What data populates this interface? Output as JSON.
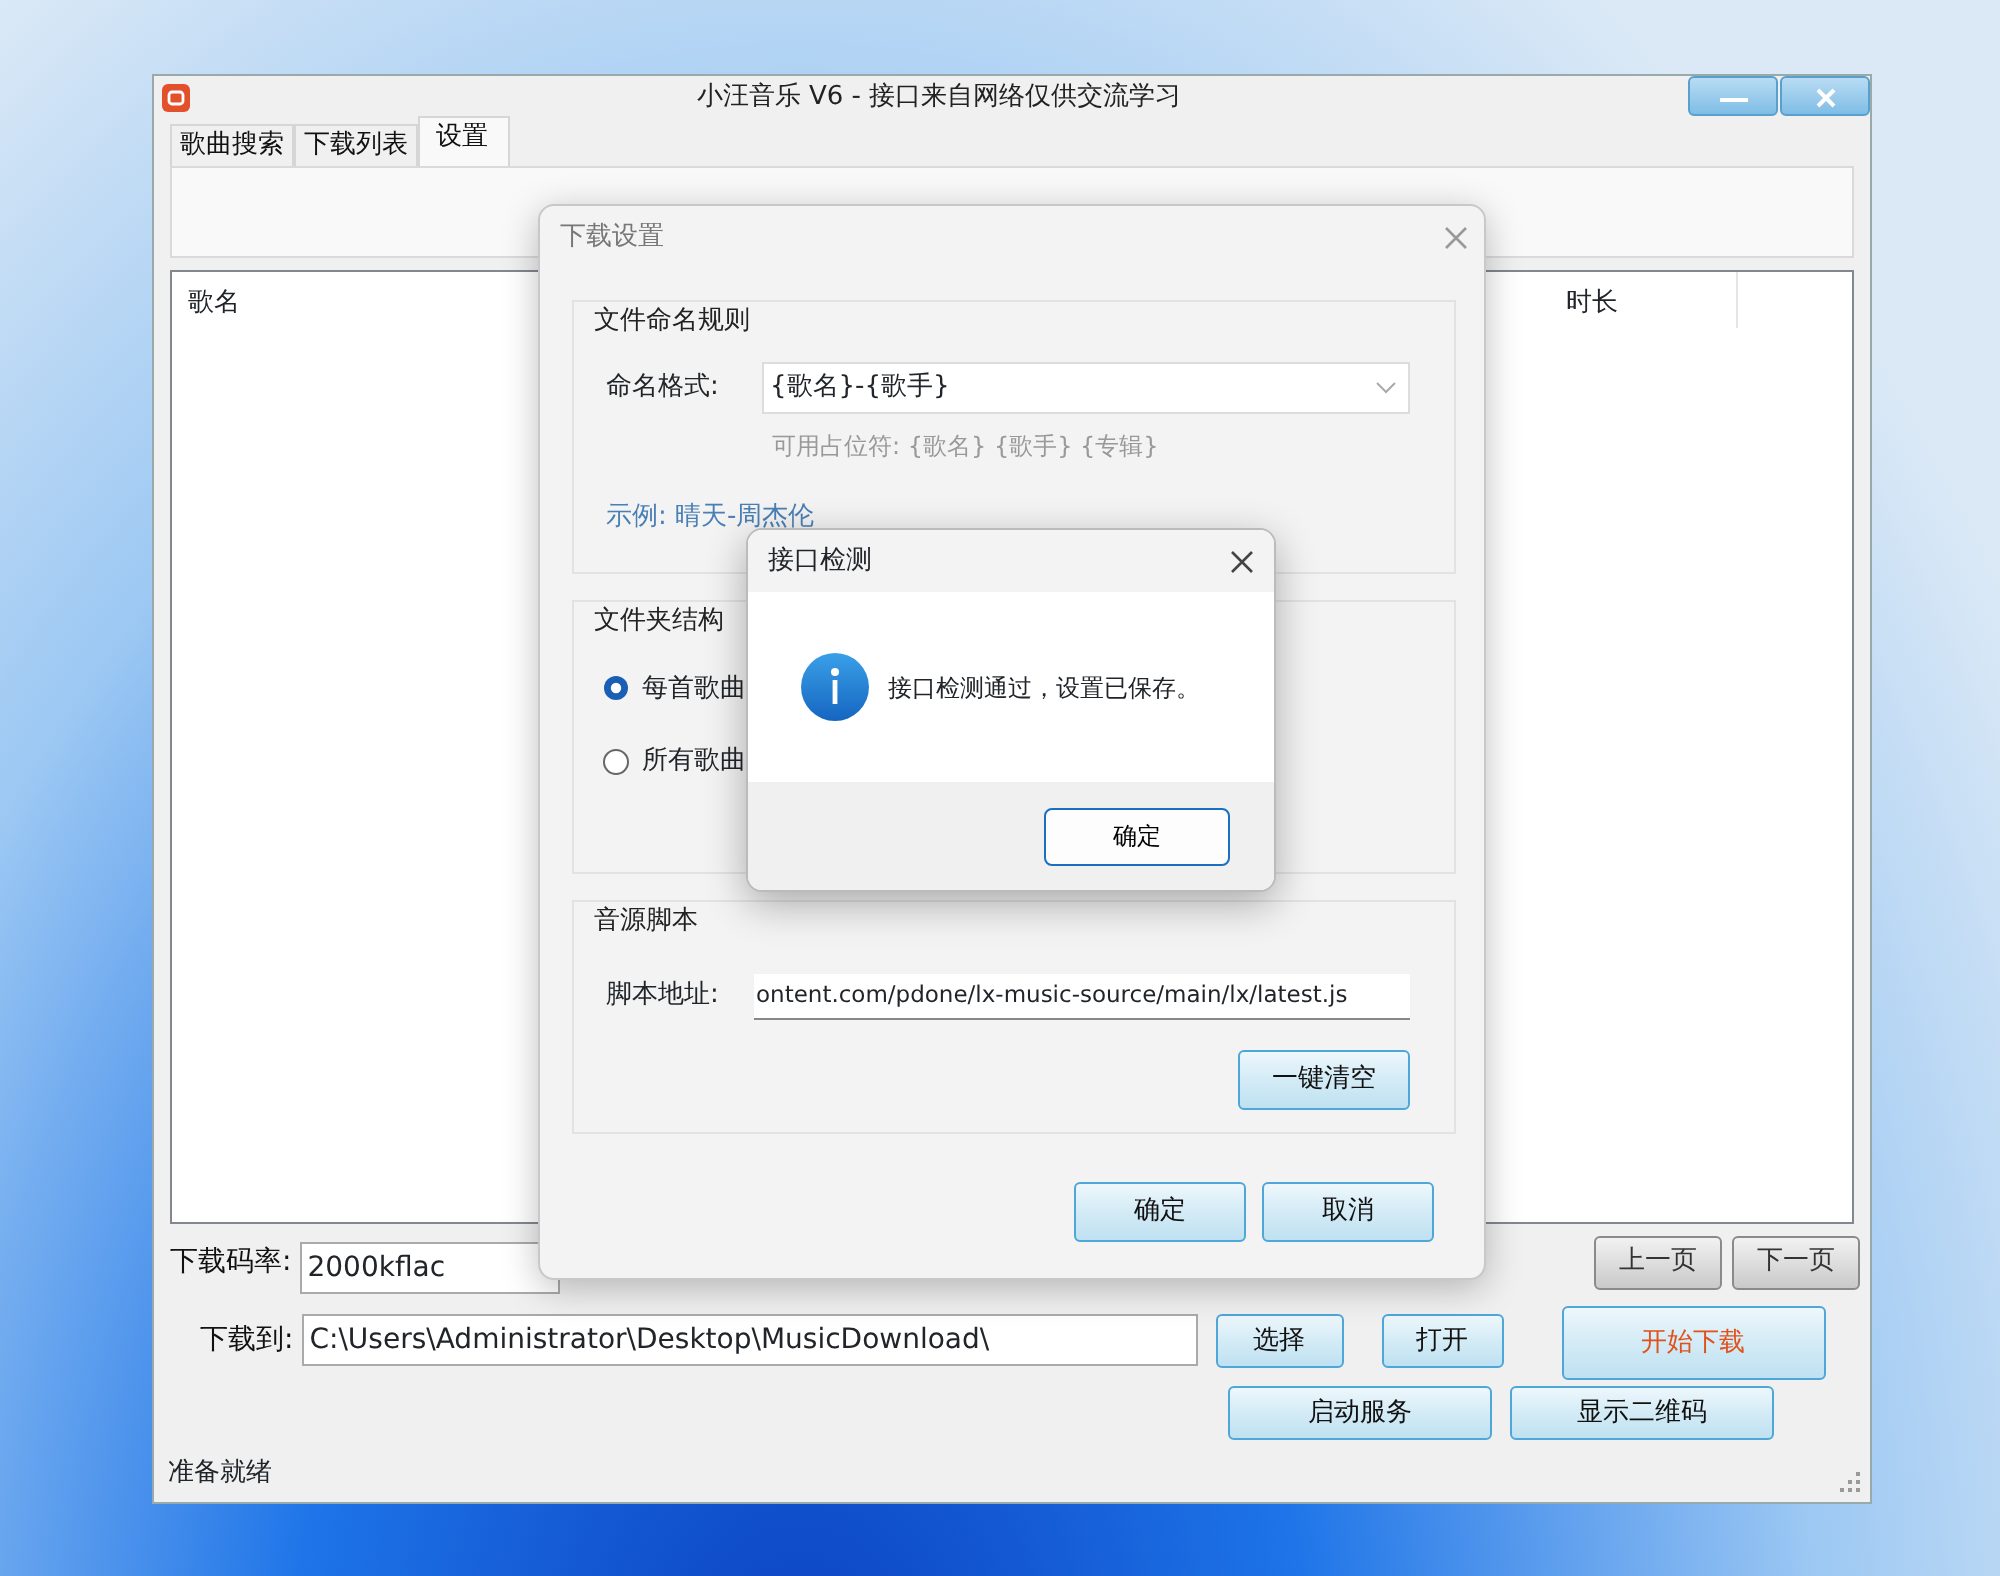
{
  "main_window": {
    "title": "小汪音乐  V6 - 接口来自网络仅供交流学习",
    "tabs": [
      {
        "label": "歌曲搜索",
        "selected": false
      },
      {
        "label": "下载列表",
        "selected": false
      },
      {
        "label": "设置",
        "selected": true
      }
    ],
    "table": {
      "columns": [
        "歌名",
        "时长"
      ]
    },
    "bitrate": {
      "label": "下载码率:",
      "value": "2000kflac"
    },
    "pager": [
      "上一页",
      "下一页"
    ],
    "path": {
      "label": "下载到:",
      "value": "C:\\Users\\Administrator\\Desktop\\MusicDownload\\"
    },
    "path_buttons": [
      "选择",
      "打开"
    ],
    "start_button": "开始下载",
    "service_buttons": [
      "启动服务",
      "显示二维码"
    ],
    "status_bar": "准备就绪"
  },
  "settings_dialog": {
    "title": "下载设置",
    "naming": {
      "title": "文件命名规则",
      "label": "命名格式:",
      "value": "{歌名}-{歌手}",
      "hint": "可用占位符: {歌名} {歌手} {专辑}",
      "example": "示例: 晴天-周杰伦"
    },
    "folder": {
      "title": "文件夹结构",
      "options": [
        {
          "label": "每首歌曲",
          "selected": true
        },
        {
          "label": "所有歌曲",
          "selected": false
        }
      ]
    },
    "source": {
      "title": "音源脚本",
      "label": "脚本地址:",
      "value": "ontent.com/pdone/lx-music-source/main/lx/latest.js",
      "clear_button": "一键清空"
    },
    "buttons": [
      "确定",
      "取消"
    ]
  },
  "message_box": {
    "title": "接口检测",
    "message": "接口检测通过，设置已保存。",
    "button": "确定"
  }
}
